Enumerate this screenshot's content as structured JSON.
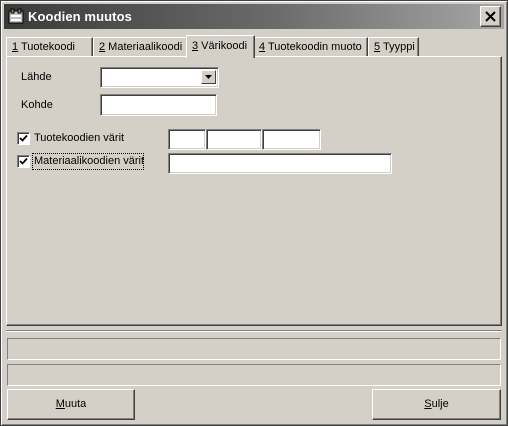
{
  "window": {
    "title": "Koodien muutos"
  },
  "tabs": [
    {
      "key": "1",
      "rest": " Tuotekoodi"
    },
    {
      "key": "2",
      "rest": " Materiaalikoodi"
    },
    {
      "key": "3",
      "rest": " Värikoodi"
    },
    {
      "key": "4",
      "rest": " Tuotekoodin muoto"
    },
    {
      "key": "5",
      "rest": " Tyyppi"
    }
  ],
  "active_tab": 2,
  "form": {
    "source_label": "Lähde",
    "source_value": "",
    "target_label": "Kohde",
    "target_value": "",
    "product_colors_label": "Tuotekoodien värit",
    "product_colors_checked": true,
    "product_color_values": [
      "",
      "",
      ""
    ],
    "material_colors_label": "Materiaalikoodien värit",
    "material_colors_checked": true,
    "material_colors_value": ""
  },
  "status": {
    "line1": "",
    "line2": ""
  },
  "buttons": {
    "change_key": "M",
    "change_rest": "uuta",
    "close_key": "S",
    "close_rest": "ulje"
  }
}
